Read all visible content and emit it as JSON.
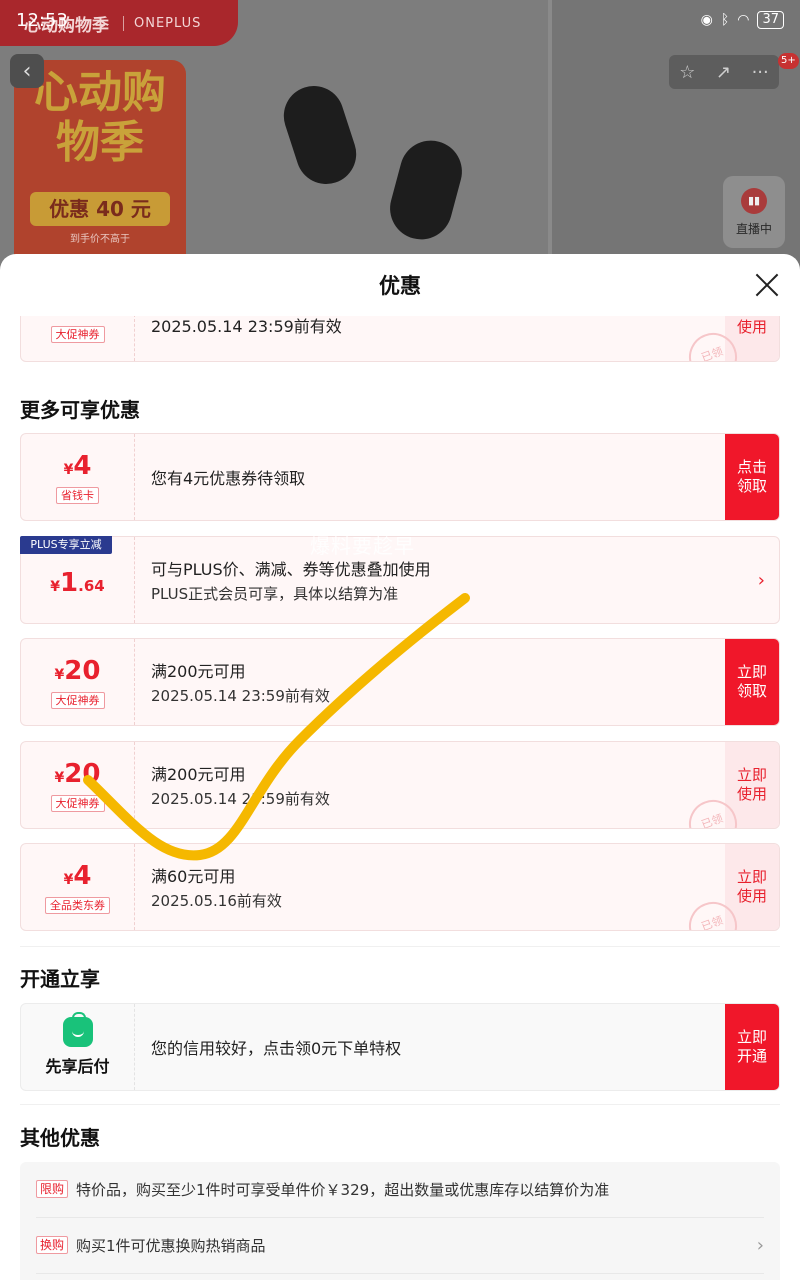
{
  "status_bar": {
    "time": "12:53",
    "battery": "37"
  },
  "background": {
    "promo_tag": "心动购物季",
    "brand": "ONEPLUS",
    "poster_title": "心动购物季",
    "poster_badge": "优惠 40 元",
    "poster_sub": "到手价不高于",
    "notification_count": "5+",
    "live_label": "直播中"
  },
  "sheet": {
    "title": "优惠",
    "top_coupon": {
      "tag": "大促神券",
      "validity": "2025.05.14 23:59前有效",
      "action": "使用"
    },
    "section_more": "更多可享优惠",
    "coupons": [
      {
        "currency": "¥",
        "amount": "4",
        "decimal": "",
        "tag": "省钱卡",
        "line1": "您有4元优惠券待领取",
        "line2": "",
        "action": "点击领取"
      },
      {
        "flag": "PLUS专享立减",
        "currency": "¥",
        "amount": "1",
        "decimal": ".64",
        "tag": "",
        "line1": "可与PLUS价、满减、券等优惠叠加使用",
        "line2": "PLUS正式会员可享，具体以结算为准",
        "action": "›"
      },
      {
        "currency": "¥",
        "amount": "20",
        "decimal": "",
        "tag": "大促神券",
        "line1": "满200元可用",
        "line2": "2025.05.14 23:59前有效",
        "action": "立即领取"
      },
      {
        "currency": "¥",
        "amount": "20",
        "decimal": "",
        "tag": "大促神券",
        "line1": "满200元可用",
        "line2": "2025.05.14 23:59前有效",
        "action": "立即使用"
      },
      {
        "currency": "¥",
        "amount": "4",
        "decimal": "",
        "tag": "全品类东券",
        "line1": "满60元可用",
        "line2": "2025.05.16前有效",
        "action": "立即使用"
      }
    ],
    "watermark": "爆料要趁早",
    "section_open": "开通立享",
    "pay": {
      "label": "先享后付",
      "text": "您的信用较好，点击领0元下单特权",
      "action": "立即开通"
    },
    "section_other": "其他优惠",
    "other": [
      {
        "tag": "限购",
        "text": "特价品，购买至少1件时可享受单件价￥329，超出数量或优惠库存以结算价为准"
      },
      {
        "tag": "换购",
        "text": "购买1件可优惠换购热销商品"
      }
    ]
  }
}
